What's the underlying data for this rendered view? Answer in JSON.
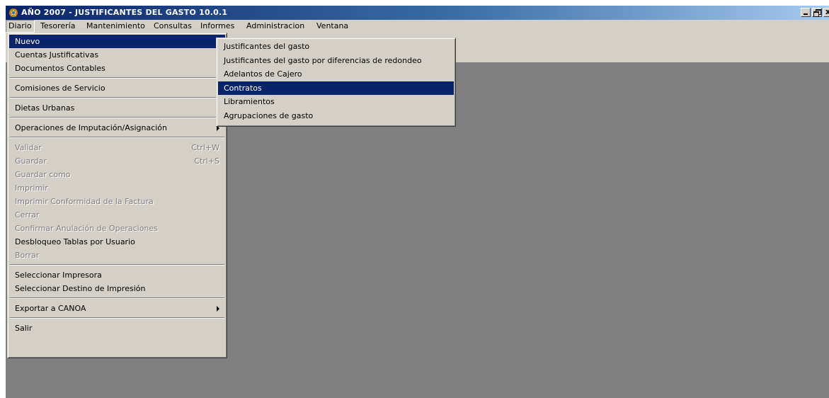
{
  "window": {
    "title": "AÑO 2007 - JUSTIFICANTES DEL GASTO 10.0.1"
  },
  "menubar": [
    {
      "label": "Diario",
      "open": true
    },
    {
      "label": "Tesorería"
    },
    {
      "label": "Mantenimiento"
    },
    {
      "label": "Consultas"
    },
    {
      "label": "Informes"
    },
    {
      "label": "Administracion"
    },
    {
      "label": "Ventana"
    }
  ],
  "diario_menu": {
    "items": {
      "nuevo": "Nuevo",
      "cuentas": "Cuentas Justificativas",
      "documentos": "Documentos Contables",
      "comisiones": "Comisiones de Servicio",
      "dietas": "Dietas Urbanas",
      "operaciones": "Operaciones de Imputación/Asignación",
      "validar": "Validar",
      "validar_shortcut": "Ctrl+W",
      "guardar": "Guardar",
      "guardar_shortcut": "Ctrl+S",
      "guardar_como": "Guardar como",
      "imprimir": "Imprimir",
      "imprimir_conformidad": "Imprimir Conformidad de la Factura",
      "cerrar": "Cerrar",
      "confirmar": "Confirmar Anulación de Operaciones",
      "desbloqueo": "Desbloqueo Tablas por Usuario",
      "borrar": "Borrar",
      "seleccionar_impresora": "Seleccionar Impresora",
      "seleccionar_destino": "Seleccionar Destino de Impresión",
      "exportar": "Exportar a CANOA",
      "salir": "Salir"
    }
  },
  "nuevo_submenu": {
    "items": [
      "Justificantes del gasto",
      "Justificantes del gasto por diferencias de redondeo",
      "Adelantos de Cajero",
      "Contratos",
      "Libramientos",
      "Agrupaciones de gasto"
    ],
    "highlighted": "Contratos"
  },
  "colors": {
    "titlebar_start": "#0a246a",
    "titlebar_end": "#a6caf0",
    "highlight": "#0a246a",
    "workspace": "#808080",
    "chrome": "#d4d0c8"
  },
  "icons": [
    "app-icon",
    "minimize-icon",
    "maximize-icon",
    "close-icon",
    "submenu-arrow-icon"
  ]
}
